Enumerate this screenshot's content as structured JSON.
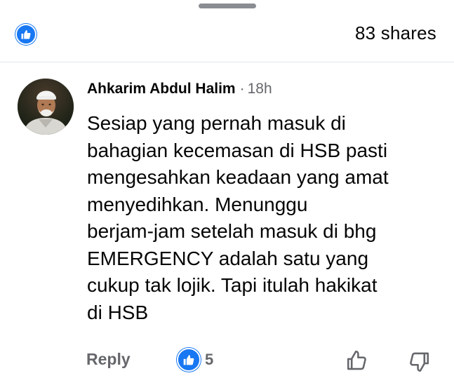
{
  "header": {
    "shares_label": "83 shares"
  },
  "comment": {
    "author": "Ahkarim Abdul Halim",
    "separator": "·",
    "time": "18h",
    "text": "Sesiap yang pernah masuk di\nbahagian kecemasan di HSB pasti\nmengesahkan keadaan yang amat\nmenyedihkan. Menunggu\nberjam-jam setelah masuk di bhg\nEMERGENCY  adalah satu yang\ncukup tak lojik. Tapi itulah hakikat\ndi HSB",
    "reply_label": "Reply",
    "reaction_count": "5"
  },
  "icons": {
    "header_reaction": "like-reaction-icon",
    "comment_reaction": "like-reaction-icon",
    "upvote": "thumb-up-outline-icon",
    "downvote": "thumb-down-outline-icon"
  },
  "colors": {
    "accent": "#1877f2",
    "text_primary": "#050505",
    "text_secondary": "#65676b",
    "handle": "#8a8d91",
    "divider": "#e4e6eb"
  }
}
